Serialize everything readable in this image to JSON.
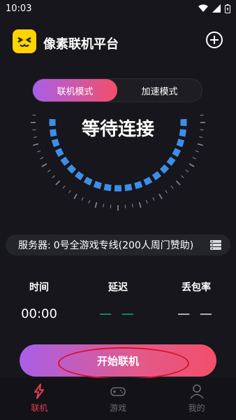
{
  "status_bar": {
    "time": "10:03"
  },
  "app": {
    "title": "像素联机平台"
  },
  "mode_switch": {
    "tabs": [
      "联机模式",
      "加速模式"
    ],
    "active_index": 0
  },
  "gauge": {
    "label": "等待连接"
  },
  "server": {
    "label": "服务器:",
    "name": "0号全游戏专线(200人周门赞助)"
  },
  "stats": {
    "time": {
      "label": "时间",
      "value": "00:00"
    },
    "latency": {
      "label": "延迟",
      "value": "— —"
    },
    "loss": {
      "label": "丢包率",
      "value": "— —"
    }
  },
  "start_button": {
    "label": "开始联机"
  },
  "bottom_nav": [
    {
      "label": "联机",
      "icon": "lightning-icon",
      "active": true
    },
    {
      "label": "游戏",
      "icon": "gamepad-icon",
      "active": false
    },
    {
      "label": "我的",
      "icon": "user-icon",
      "active": false
    }
  ],
  "colors": {
    "background": "#16161c",
    "accent_start": "#a85fe8",
    "accent_end": "#f24f6a",
    "gauge_blue": "#3d8ee8",
    "latency_green": "#23c16b",
    "annotation_red": "#d4122a"
  }
}
